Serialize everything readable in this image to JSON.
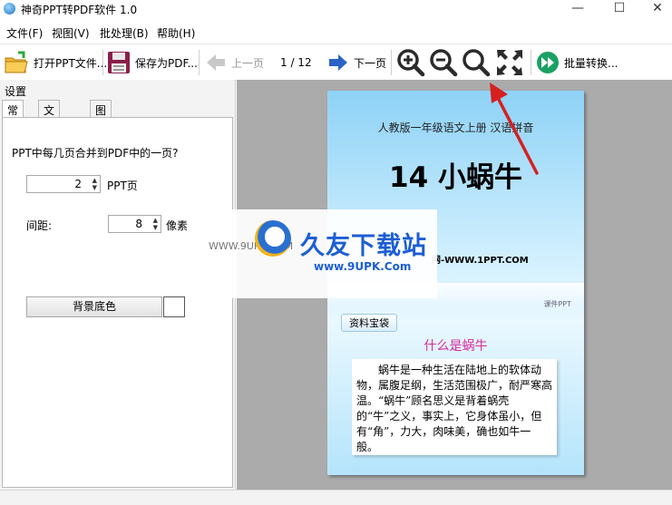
{
  "window": {
    "title": "神奇PPT转PDF软件 1.0",
    "controls": {
      "minimize": "—",
      "maximize": "☐",
      "close": "✕"
    }
  },
  "menu": [
    "文件(F)",
    "视图(V)",
    "批处理(B)",
    "帮助(H)"
  ],
  "toolbar": {
    "open_label": "打开PPT文件...",
    "save_label": "保存为PDF...",
    "prev_label": "上一页",
    "page_indicator": "1 / 12",
    "next_label": "下一页",
    "batch_label": "批量转换..."
  },
  "settings": {
    "header": "设置",
    "tabs": [
      "常规",
      "文字水印",
      "图片水印"
    ],
    "question": "PPT中每几页合并到PDF中的一页?",
    "pages_value": "2",
    "pages_unit": "PPT页",
    "spacing_label": "间距:",
    "spacing_value": "8",
    "spacing_unit": "像素",
    "background_button": "背景底色"
  },
  "slide": {
    "subtitle": "人教版一年级语文上册   汉语拼音",
    "title": "14 小蜗牛",
    "url_text": "网-WWW.1PPT.COM",
    "brand": "课件PPT",
    "tag": "资料宝袋",
    "question": "什么是蜗牛",
    "body": "蜗牛是一种生活在陆地上的软体动物，属腹足纲，生活范围极广，耐严寒高温。“蜗牛”顾名思义是背着蜗壳的“牛”之义，事实上，它身体虽小，但有“角”，力大，肉味美，确也如牛一般。"
  },
  "watermark": {
    "text_cn": "久友下载站",
    "url": "www.9UPK.Com",
    "side_text": "WWW.9UPK.COM"
  },
  "colors": {
    "accent_blue": "#1c5ed4",
    "arrow_red": "#d62020",
    "preview_bg": "#ababab"
  }
}
